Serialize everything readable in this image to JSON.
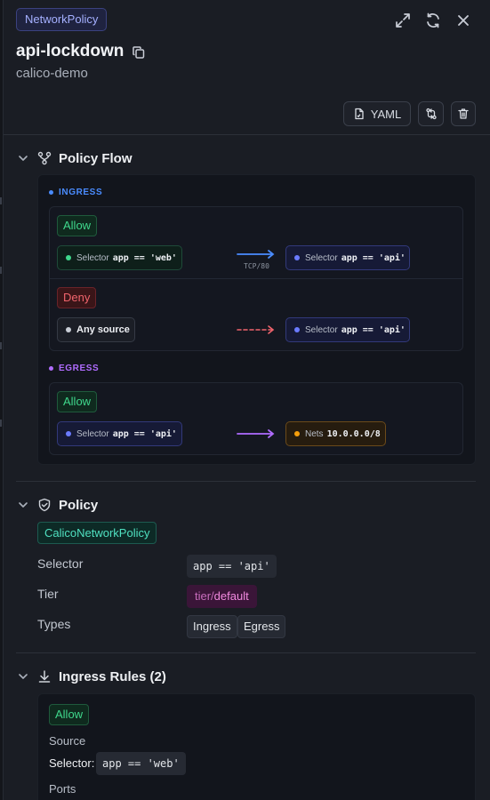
{
  "header": {
    "kind": "NetworkPolicy",
    "name": "api-lockdown",
    "namespace": "calico-demo",
    "icons": [
      "expand-icon",
      "refresh-icon",
      "close-icon",
      "copy-icon"
    ]
  },
  "toolbar": {
    "yaml_label": "YAML",
    "icons": [
      "yaml-file-icon",
      "compare-icon",
      "trash-icon"
    ]
  },
  "policy_flow": {
    "title": "Policy Flow",
    "ingress": {
      "label": "INGRESS",
      "rules": [
        {
          "action": "Allow",
          "source": {
            "prefix": "Selector",
            "value": "app == 'web'"
          },
          "port": "TCP/80",
          "target": {
            "prefix": "Selector",
            "value": "app == 'api'"
          }
        },
        {
          "action": "Deny",
          "source": {
            "label": "Any source"
          },
          "target": {
            "prefix": "Selector",
            "value": "app == 'api'"
          }
        }
      ]
    },
    "egress": {
      "label": "EGRESS",
      "rules": [
        {
          "action": "Allow",
          "source": {
            "prefix": "Selector",
            "value": "app == 'api'"
          },
          "target": {
            "prefix": "Nets",
            "value": "10.0.0.0/8"
          }
        }
      ]
    }
  },
  "policy": {
    "title": "Policy",
    "type_badge": "CalicoNetworkPolicy",
    "selector_label": "Selector",
    "selector_value": "app == 'api'",
    "tier_label": "Tier",
    "tier_prefix": "tier/",
    "tier_value": "default",
    "types_label": "Types",
    "types": [
      "Ingress",
      "Egress"
    ]
  },
  "ingress_rules": {
    "title": "Ingress Rules (2)",
    "first_rule": {
      "action": "Allow",
      "source_label": "Source",
      "selector_label": "Selector:",
      "selector_value": "app == 'web'",
      "ports_label": "Ports"
    }
  },
  "colors": {
    "accent_indigo": "#a5b0ff",
    "allow_green": "#3fd88c",
    "deny_red": "#f0646c",
    "ingress_blue": "#4a8cff",
    "egress_purple": "#b06cff",
    "nets_orange": "#f59e0b"
  }
}
